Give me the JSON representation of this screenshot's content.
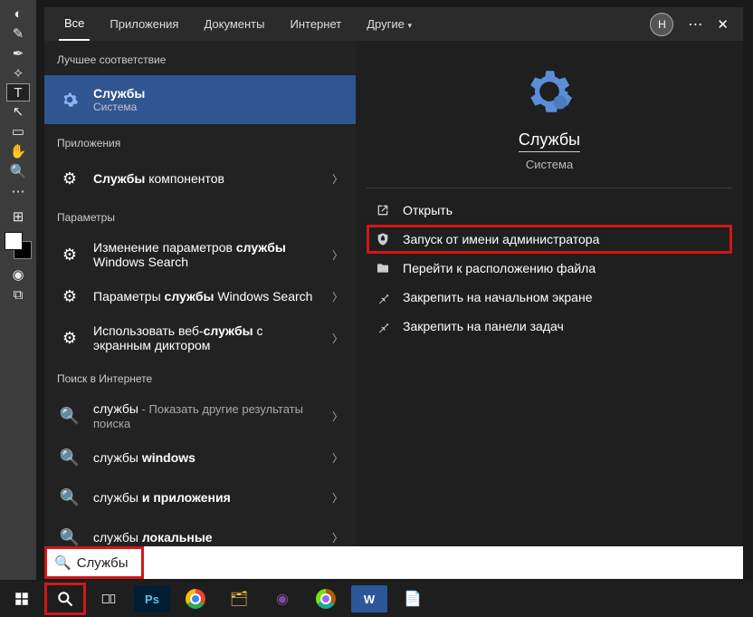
{
  "left_toolbar": {
    "tools": [
      "eyedropper",
      "healing",
      "brush",
      "stamp",
      "text",
      "arrow",
      "rect",
      "hand",
      "zoom",
      "more"
    ]
  },
  "tabs": {
    "items": [
      "Все",
      "Приложения",
      "Документы",
      "Интернет",
      "Другие"
    ],
    "active_index": 0,
    "avatar_letter": "Н"
  },
  "sections": {
    "best_match": "Лучшее соответствие",
    "apps": "Приложения",
    "settings": "Параметры",
    "web": "Поиск в Интернете"
  },
  "best_match_item": {
    "title": "Службы",
    "subtitle": "Система"
  },
  "apps_items": [
    {
      "prefix": "Службы",
      "suffix": " компонентов"
    }
  ],
  "settings_items": [
    {
      "pre": "Изменение параметров ",
      "strong": "службы",
      "post": " Windows Search"
    },
    {
      "pre": "Параметры ",
      "strong": "службы",
      "post": " Windows Search"
    },
    {
      "pre": "Использовать веб-",
      "strong": "службы",
      "post": " с экранным диктором"
    }
  ],
  "web_items": [
    {
      "q": "службы",
      "trail": " - Показать другие результаты поиска"
    },
    {
      "q": "службы ",
      "strong": "windows"
    },
    {
      "pre": "службы ",
      "strong": "и приложения"
    },
    {
      "pre": "службы ",
      "strong": "локальные"
    }
  ],
  "detail": {
    "title": "Службы",
    "subtitle": "Система"
  },
  "actions": [
    {
      "id": "open",
      "label": "Открыть"
    },
    {
      "id": "runas",
      "label": "Запуск от имени администратора",
      "highlighted": true
    },
    {
      "id": "location",
      "label": "Перейти к расположению файла"
    },
    {
      "id": "pin-start",
      "label": "Закрепить на начальном экране"
    },
    {
      "id": "pin-taskbar",
      "label": "Закрепить на панели задач"
    }
  ],
  "search": {
    "value": "Службы"
  }
}
